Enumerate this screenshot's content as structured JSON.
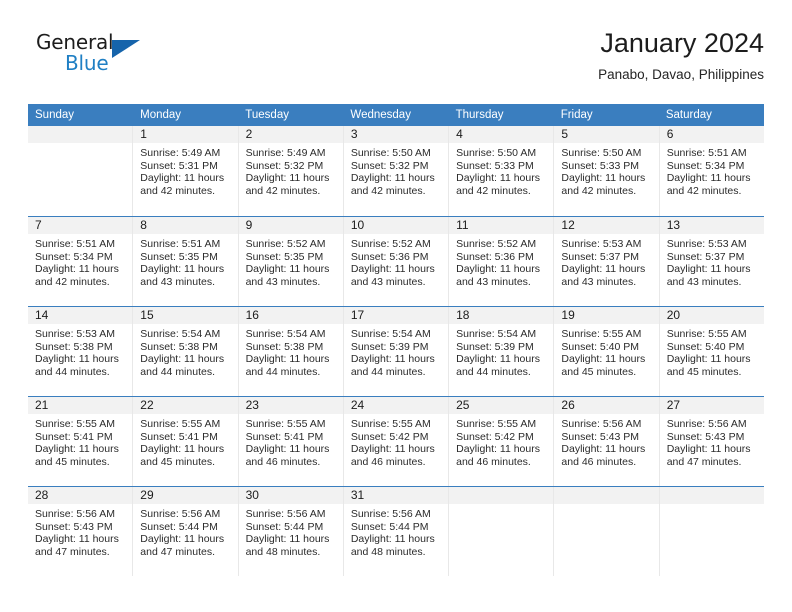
{
  "brand": {
    "name_part1": "General",
    "name_part2": "Blue",
    "triangle_color": "#1664ab",
    "blue_color": "#1f7fc4"
  },
  "header": {
    "title": "January 2024",
    "subtitle": "Panabo, Davao, Philippines"
  },
  "theme": {
    "header_blue": "#3a7ebf",
    "day_band_gray": "#f2f2f2",
    "text_color": "#2b2b2b"
  },
  "weekdays": [
    "Sunday",
    "Monday",
    "Tuesday",
    "Wednesday",
    "Thursday",
    "Friday",
    "Saturday"
  ],
  "weeks": [
    [
      {
        "day": "",
        "sunrise": "",
        "sunset": "",
        "daylight1": "",
        "daylight2": ""
      },
      {
        "day": "1",
        "sunrise": "Sunrise: 5:49 AM",
        "sunset": "Sunset: 5:31 PM",
        "daylight1": "Daylight: 11 hours",
        "daylight2": "and 42 minutes."
      },
      {
        "day": "2",
        "sunrise": "Sunrise: 5:49 AM",
        "sunset": "Sunset: 5:32 PM",
        "daylight1": "Daylight: 11 hours",
        "daylight2": "and 42 minutes."
      },
      {
        "day": "3",
        "sunrise": "Sunrise: 5:50 AM",
        "sunset": "Sunset: 5:32 PM",
        "daylight1": "Daylight: 11 hours",
        "daylight2": "and 42 minutes."
      },
      {
        "day": "4",
        "sunrise": "Sunrise: 5:50 AM",
        "sunset": "Sunset: 5:33 PM",
        "daylight1": "Daylight: 11 hours",
        "daylight2": "and 42 minutes."
      },
      {
        "day": "5",
        "sunrise": "Sunrise: 5:50 AM",
        "sunset": "Sunset: 5:33 PM",
        "daylight1": "Daylight: 11 hours",
        "daylight2": "and 42 minutes."
      },
      {
        "day": "6",
        "sunrise": "Sunrise: 5:51 AM",
        "sunset": "Sunset: 5:34 PM",
        "daylight1": "Daylight: 11 hours",
        "daylight2": "and 42 minutes."
      }
    ],
    [
      {
        "day": "7",
        "sunrise": "Sunrise: 5:51 AM",
        "sunset": "Sunset: 5:34 PM",
        "daylight1": "Daylight: 11 hours",
        "daylight2": "and 42 minutes."
      },
      {
        "day": "8",
        "sunrise": "Sunrise: 5:51 AM",
        "sunset": "Sunset: 5:35 PM",
        "daylight1": "Daylight: 11 hours",
        "daylight2": "and 43 minutes."
      },
      {
        "day": "9",
        "sunrise": "Sunrise: 5:52 AM",
        "sunset": "Sunset: 5:35 PM",
        "daylight1": "Daylight: 11 hours",
        "daylight2": "and 43 minutes."
      },
      {
        "day": "10",
        "sunrise": "Sunrise: 5:52 AM",
        "sunset": "Sunset: 5:36 PM",
        "daylight1": "Daylight: 11 hours",
        "daylight2": "and 43 minutes."
      },
      {
        "day": "11",
        "sunrise": "Sunrise: 5:52 AM",
        "sunset": "Sunset: 5:36 PM",
        "daylight1": "Daylight: 11 hours",
        "daylight2": "and 43 minutes."
      },
      {
        "day": "12",
        "sunrise": "Sunrise: 5:53 AM",
        "sunset": "Sunset: 5:37 PM",
        "daylight1": "Daylight: 11 hours",
        "daylight2": "and 43 minutes."
      },
      {
        "day": "13",
        "sunrise": "Sunrise: 5:53 AM",
        "sunset": "Sunset: 5:37 PM",
        "daylight1": "Daylight: 11 hours",
        "daylight2": "and 43 minutes."
      }
    ],
    [
      {
        "day": "14",
        "sunrise": "Sunrise: 5:53 AM",
        "sunset": "Sunset: 5:38 PM",
        "daylight1": "Daylight: 11 hours",
        "daylight2": "and 44 minutes."
      },
      {
        "day": "15",
        "sunrise": "Sunrise: 5:54 AM",
        "sunset": "Sunset: 5:38 PM",
        "daylight1": "Daylight: 11 hours",
        "daylight2": "and 44 minutes."
      },
      {
        "day": "16",
        "sunrise": "Sunrise: 5:54 AM",
        "sunset": "Sunset: 5:38 PM",
        "daylight1": "Daylight: 11 hours",
        "daylight2": "and 44 minutes."
      },
      {
        "day": "17",
        "sunrise": "Sunrise: 5:54 AM",
        "sunset": "Sunset: 5:39 PM",
        "daylight1": "Daylight: 11 hours",
        "daylight2": "and 44 minutes."
      },
      {
        "day": "18",
        "sunrise": "Sunrise: 5:54 AM",
        "sunset": "Sunset: 5:39 PM",
        "daylight1": "Daylight: 11 hours",
        "daylight2": "and 44 minutes."
      },
      {
        "day": "19",
        "sunrise": "Sunrise: 5:55 AM",
        "sunset": "Sunset: 5:40 PM",
        "daylight1": "Daylight: 11 hours",
        "daylight2": "and 45 minutes."
      },
      {
        "day": "20",
        "sunrise": "Sunrise: 5:55 AM",
        "sunset": "Sunset: 5:40 PM",
        "daylight1": "Daylight: 11 hours",
        "daylight2": "and 45 minutes."
      }
    ],
    [
      {
        "day": "21",
        "sunrise": "Sunrise: 5:55 AM",
        "sunset": "Sunset: 5:41 PM",
        "daylight1": "Daylight: 11 hours",
        "daylight2": "and 45 minutes."
      },
      {
        "day": "22",
        "sunrise": "Sunrise: 5:55 AM",
        "sunset": "Sunset: 5:41 PM",
        "daylight1": "Daylight: 11 hours",
        "daylight2": "and 45 minutes."
      },
      {
        "day": "23",
        "sunrise": "Sunrise: 5:55 AM",
        "sunset": "Sunset: 5:41 PM",
        "daylight1": "Daylight: 11 hours",
        "daylight2": "and 46 minutes."
      },
      {
        "day": "24",
        "sunrise": "Sunrise: 5:55 AM",
        "sunset": "Sunset: 5:42 PM",
        "daylight1": "Daylight: 11 hours",
        "daylight2": "and 46 minutes."
      },
      {
        "day": "25",
        "sunrise": "Sunrise: 5:55 AM",
        "sunset": "Sunset: 5:42 PM",
        "daylight1": "Daylight: 11 hours",
        "daylight2": "and 46 minutes."
      },
      {
        "day": "26",
        "sunrise": "Sunrise: 5:56 AM",
        "sunset": "Sunset: 5:43 PM",
        "daylight1": "Daylight: 11 hours",
        "daylight2": "and 46 minutes."
      },
      {
        "day": "27",
        "sunrise": "Sunrise: 5:56 AM",
        "sunset": "Sunset: 5:43 PM",
        "daylight1": "Daylight: 11 hours",
        "daylight2": "and 47 minutes."
      }
    ],
    [
      {
        "day": "28",
        "sunrise": "Sunrise: 5:56 AM",
        "sunset": "Sunset: 5:43 PM",
        "daylight1": "Daylight: 11 hours",
        "daylight2": "and 47 minutes."
      },
      {
        "day": "29",
        "sunrise": "Sunrise: 5:56 AM",
        "sunset": "Sunset: 5:44 PM",
        "daylight1": "Daylight: 11 hours",
        "daylight2": "and 47 minutes."
      },
      {
        "day": "30",
        "sunrise": "Sunrise: 5:56 AM",
        "sunset": "Sunset: 5:44 PM",
        "daylight1": "Daylight: 11 hours",
        "daylight2": "and 48 minutes."
      },
      {
        "day": "31",
        "sunrise": "Sunrise: 5:56 AM",
        "sunset": "Sunset: 5:44 PM",
        "daylight1": "Daylight: 11 hours",
        "daylight2": "and 48 minutes."
      },
      {
        "day": "",
        "sunrise": "",
        "sunset": "",
        "daylight1": "",
        "daylight2": ""
      },
      {
        "day": "",
        "sunrise": "",
        "sunset": "",
        "daylight1": "",
        "daylight2": ""
      },
      {
        "day": "",
        "sunrise": "",
        "sunset": "",
        "daylight1": "",
        "daylight2": ""
      }
    ]
  ]
}
